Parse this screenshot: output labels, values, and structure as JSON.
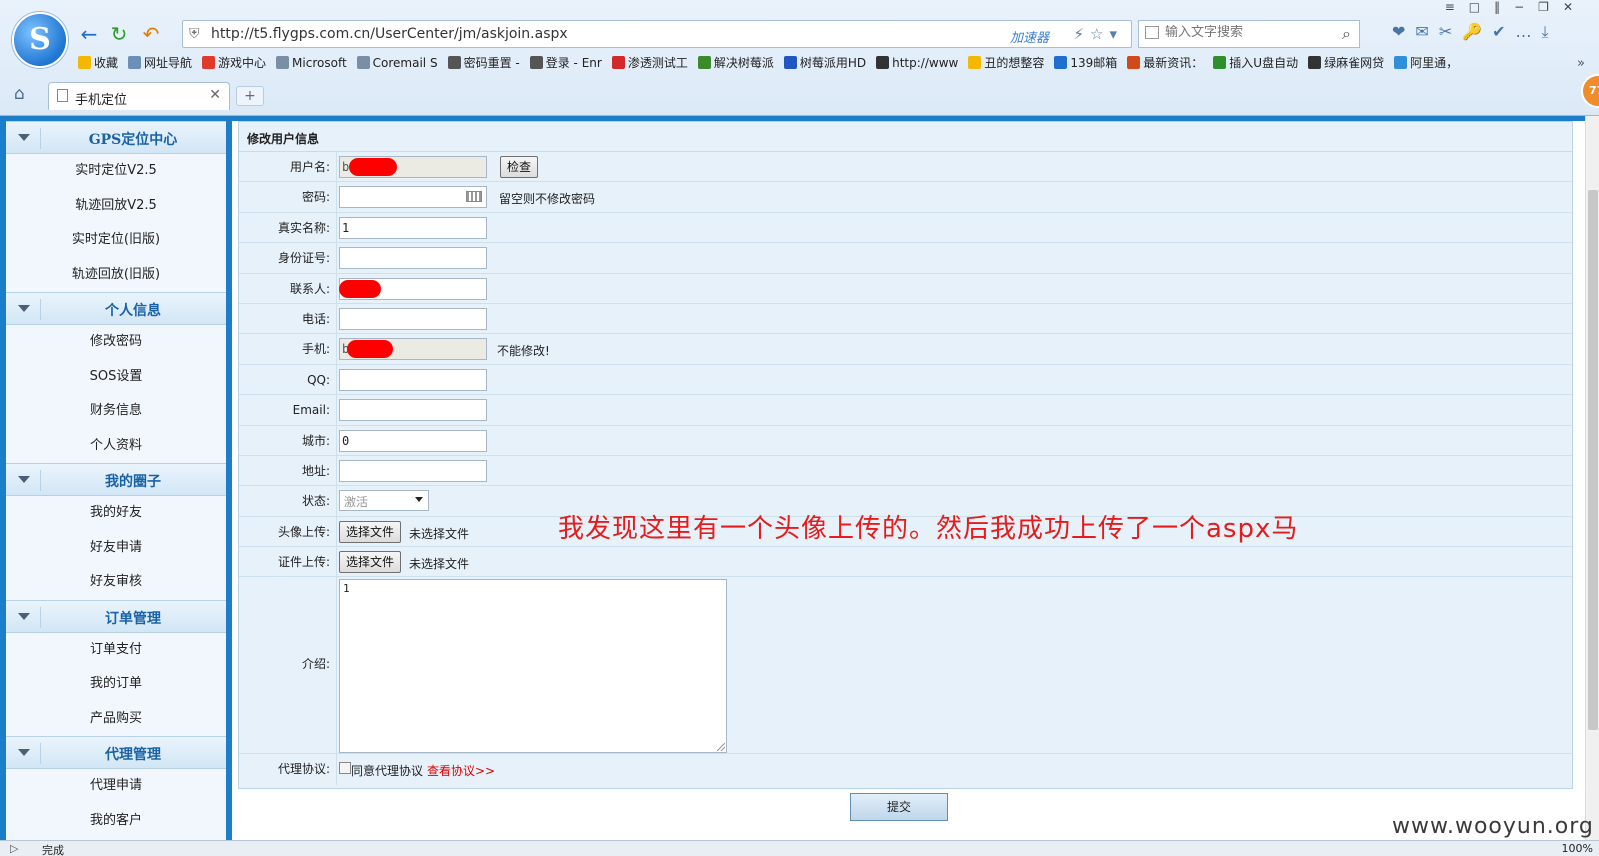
{
  "browser": {
    "logo_letter": "S",
    "url": "http://t5.flygps.com.cn/UserCenter/jm/askjoin.aspx",
    "accelerator": "加速器",
    "search_placeholder": "输入文字搜索",
    "bookmarks": [
      {
        "label": "收藏",
        "color": "#f5b800"
      },
      {
        "label": "网址导航",
        "color": "#6b8fb8"
      },
      {
        "label": "游戏中心",
        "color": "#e23a2a"
      },
      {
        "label": "Microsoft",
        "color": "#7a8ea6"
      },
      {
        "label": "Coremail S",
        "color": "#7a8ea6"
      },
      {
        "label": "密码重置 -",
        "color": "#555555"
      },
      {
        "label": "登录 - Enr",
        "color": "#555555"
      },
      {
        "label": "渗透测试工",
        "color": "#d22a2a"
      },
      {
        "label": "解决树莓派",
        "color": "#3c8a2c"
      },
      {
        "label": "树莓派用HD",
        "color": "#1f56c2"
      },
      {
        "label": "http://www",
        "color": "#333333"
      },
      {
        "label": "丑的想整容",
        "color": "#f5b800"
      },
      {
        "label": "139邮箱",
        "color": "#1f6fd0"
      },
      {
        "label": "最新资讯：",
        "color": "#d04a1a"
      },
      {
        "label": "插入U盘自动",
        "color": "#2f8f2f"
      },
      {
        "label": "绿麻雀网贷",
        "color": "#333333"
      },
      {
        "label": "阿里通，",
        "color": "#2f8fd8"
      }
    ],
    "tab_label": "手机定位",
    "badge": "77",
    "status_text": "完成",
    "zoom": "100%"
  },
  "sidebar": {
    "sections": [
      {
        "title": "GPS定位中心",
        "items": [
          "实时定位V2.5",
          "轨迹回放V2.5",
          "实时定位(旧版)",
          "轨迹回放(旧版)"
        ]
      },
      {
        "title": "个人信息",
        "items": [
          "修改密码",
          "SOS设置",
          "财务信息",
          "个人资料"
        ]
      },
      {
        "title": "我的圈子",
        "items": [
          "我的好友",
          "好友申请",
          "好友审核"
        ]
      },
      {
        "title": "订单管理",
        "items": [
          "订单支付",
          "我的订单",
          "产品购买"
        ]
      },
      {
        "title": "代理管理",
        "items": [
          "代理申请",
          "我的客户"
        ]
      }
    ]
  },
  "form": {
    "title": "修改用户信息",
    "username_label": "用户名:",
    "username_value": "b",
    "check_button": "检查",
    "password_label": "密码:",
    "password_note": "留空则不修改密码",
    "realname_label": "真实名称:",
    "realname_value": "1",
    "idcard_label": "身份证号:",
    "contact_label": "联系人:",
    "phone_label": "电话:",
    "mobile_label": "手机:",
    "mobile_value": "b",
    "mobile_note": "不能修改!",
    "qq_label": "QQ:",
    "email_label": "Email:",
    "city_label": "城市:",
    "city_value": "0",
    "address_label": "地址:",
    "status_label": "状态:",
    "status_value": "激活",
    "avatar_label": "头像上传:",
    "cert_label": "证件上传:",
    "choose_file": "选择文件",
    "no_file": "未选择文件",
    "intro_label": "介绍:",
    "intro_value": "1",
    "agent_label": "代理协议:",
    "agree_text": "同意代理协议",
    "view_agreement": "查看协议>>",
    "submit": "提交"
  },
  "annotation": "我发现这里有一个头像上传的。然后我成功上传了一个aspx马",
  "watermark": "www.wooyun.org"
}
